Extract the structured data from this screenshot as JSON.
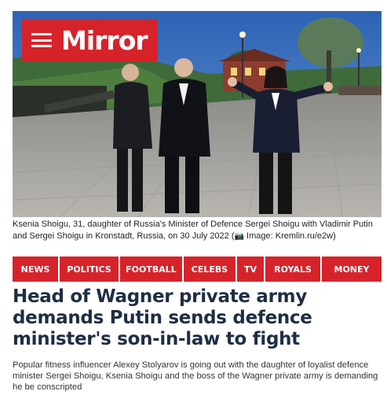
{
  "header": {
    "logo_text": "Mirror",
    "menu_icon": "hamburger-menu-icon",
    "brand_color": "#d6232a"
  },
  "photo": {
    "caption": "Ksenia Shoigu, 31, daughter of Russia's Minister of Defence Sergei Shoigu with Vladimir Putin and Sergei Shoigu in Kronstadt, Russia, on 30 July 2022",
    "credit_icon": "camera-icon",
    "credit": "Image: Kremlin.ru/e2w)"
  },
  "nav": {
    "items": [
      "NEWS",
      "POLITICS",
      "FOOTBALL",
      "CELEBS",
      "TV",
      "ROYALS",
      "MONEY"
    ]
  },
  "article": {
    "headline": "Head of Wagner private army demands Putin sends defence minister's son-in-law to fight",
    "standfirst": "Popular fitness influencer Alexey Stolyarov is going out with the daughter of loyalist defence minister Sergei Shoigu, Ksenia Shoigu and the boss of the Wagner private army is demanding he be conscripted",
    "headline_color": "#1e2e44"
  }
}
